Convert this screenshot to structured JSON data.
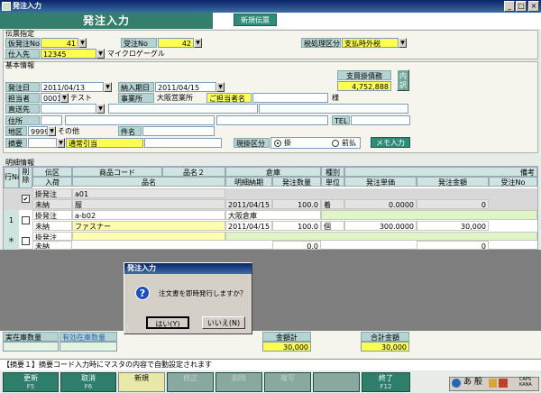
{
  "window": {
    "title": "発注入力",
    "min": "_",
    "max": "□",
    "close": "×"
  },
  "header": {
    "title": "発注入力",
    "new_slip": "新規伝票"
  },
  "slip": {
    "section": "伝票指定",
    "order_no_label": "仮発注No",
    "order_no": "41",
    "recv_no_label": "受注No",
    "recv_no": "42",
    "tax_label": "税処理区分",
    "tax": "支払時外税",
    "supplier_label": "仕入先",
    "supplier_code": "12345",
    "supplier_name": "マイクロゲーグル"
  },
  "basic": {
    "section": "基本情報",
    "order_date_label": "発注日",
    "order_date": "2011/04/13",
    "delivery_label": "納入期日",
    "delivery": "2011/04/15",
    "payable_label": "支買掛債務",
    "payable": "4,752,888",
    "detail_btn": "内訳",
    "staff_label": "担当者",
    "staff_code": "0001",
    "staff_name": "テスト",
    "office_label": "事業所",
    "office": "大阪営業所",
    "contact_label": "ご担当者名",
    "contact_suffix": "様",
    "direct_label": "直送先",
    "address_label": "住所",
    "tel_label": "TEL",
    "area_label": "地区",
    "area_code": "9999",
    "area_name": "その他",
    "subject_label": "件名",
    "summary_label": "摘要",
    "summary": "通常引当",
    "cash_label": "現掛区分",
    "cash_opt1": "掛",
    "cash_opt2": "前払",
    "memo_btn": "メモ入力"
  },
  "detail": {
    "section": "明細情報",
    "headers": {
      "row": "行No",
      "del": "削除",
      "slip_type": "伝区",
      "code": "商品コード",
      "name2": "品名２",
      "warehouse": "倉庫",
      "kind": "種別",
      "remark": "備考",
      "receive": "入荷",
      "name": "品名",
      "due": "明細納期",
      "qty": "発注数量",
      "unit": "単位",
      "price": "発注単価",
      "amount": "発注金額",
      "recv_no": "受注No"
    },
    "rows": [
      {
        "no": "",
        "t1": "掛発注",
        "t2": "未納",
        "code": "a01",
        "name": "服",
        "due": "2011/04/15",
        "qty": "100.0",
        "unit": "着",
        "price": "0.0000",
        "amount": "0",
        "checked": true
      },
      {
        "no": "1",
        "t1": "掛発注",
        "t2": "未納",
        "code": "a-b02",
        "name": "ファスナー",
        "warehouse": "大阪倉庫",
        "due": "2011/04/15",
        "qty": "100.0",
        "unit": "個",
        "price": "300.0000",
        "amount": "30,000",
        "checked": false
      },
      {
        "no": "＊",
        "t1": "掛発注",
        "t2": "未納",
        "code": "",
        "name": "",
        "qty": "0.0",
        "price": "",
        "amount": "0",
        "checked": false
      }
    ]
  },
  "footer": {
    "stock_label": "実在庫数量",
    "avail_label": "有効在庫数量",
    "amount_label": "金額計",
    "amount": "30,000",
    "total_label": "合計金額",
    "total": "30,000"
  },
  "status": "【摘要１】摘要コード入力時にマスタの内容で自動設定されます",
  "fkeys": [
    {
      "label": "更新",
      "key": "F5",
      "state": "on"
    },
    {
      "label": "取消",
      "key": "F6",
      "state": "on"
    },
    {
      "label": "新規",
      "key": "",
      "state": "hl"
    },
    {
      "label": "修正",
      "key": "",
      "state": "dis"
    },
    {
      "label": "削除",
      "key": "",
      "state": "dis"
    },
    {
      "label": "複写",
      "key": "",
      "state": "dis"
    },
    {
      "label": "",
      "key": "",
      "state": "dis"
    },
    {
      "label": "終了",
      "key": "F12",
      "state": "on"
    }
  ],
  "dialog": {
    "title": "発注入力",
    "message": "注文書を即時発行しますか？",
    "yes": "はい(Y)",
    "no": "いいえ(N)"
  },
  "tray": {
    "ime": "あ 般",
    "caps": "CAPS",
    "kana": "KANA"
  }
}
